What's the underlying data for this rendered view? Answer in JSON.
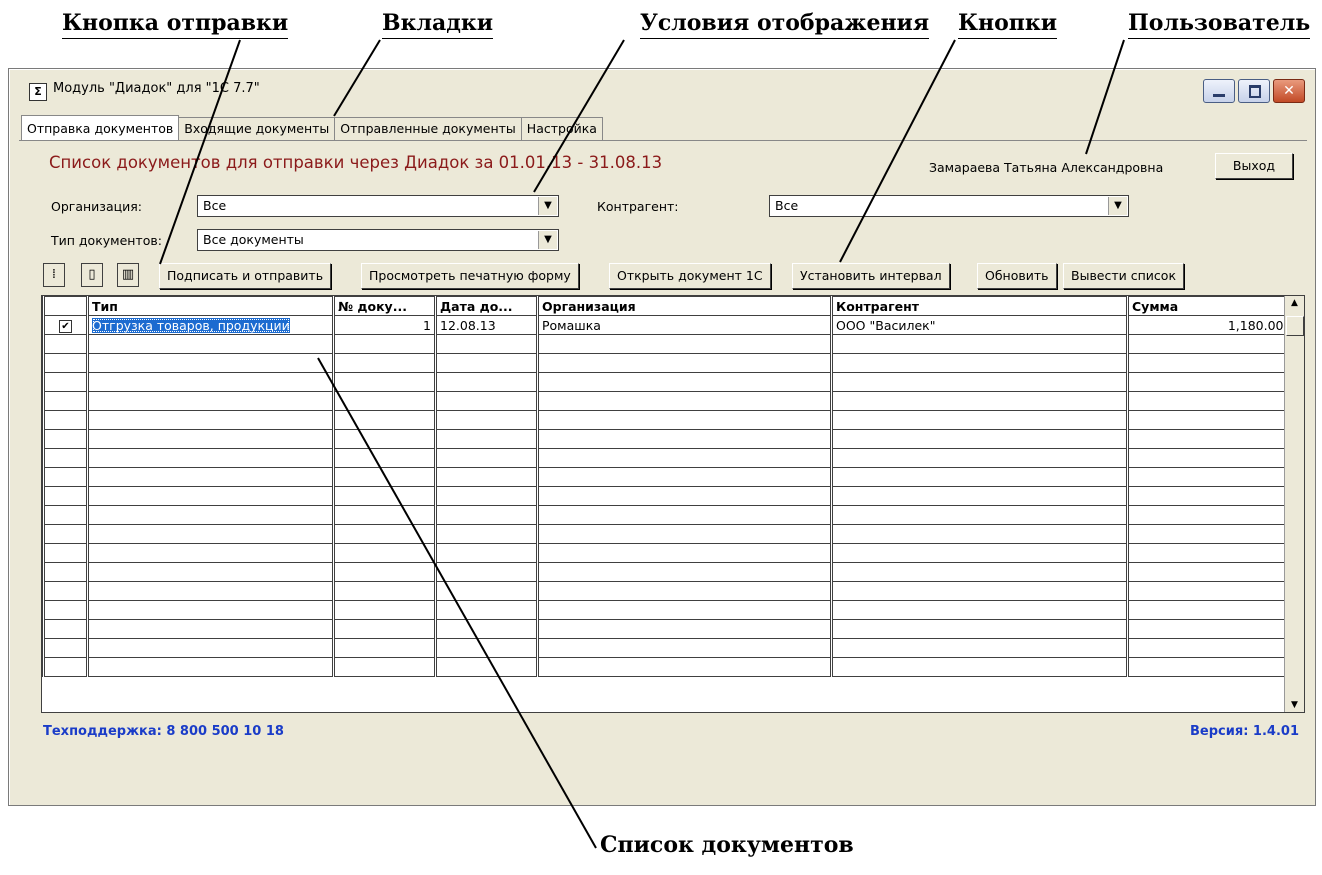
{
  "annotations": {
    "send_button": "Кнопка отправки",
    "tabs": "Вкладки",
    "display_conditions": "Условия отображения",
    "buttons": "Кнопки",
    "user": "Пользователь",
    "doc_list": "Список документов"
  },
  "window": {
    "icon": "Σ",
    "title": "Модуль \"Диадок\" для \"1С 7.7\"",
    "close_glyph": "✕"
  },
  "tabs": [
    {
      "label": "Отправка документов",
      "active": true
    },
    {
      "label": "Входящие документы"
    },
    {
      "label": "Отправленные документы"
    },
    {
      "label": "Настройка"
    }
  ],
  "header": {
    "list_heading": "Список документов для отправки через Диадок за 01.01.13 - 31.08.13",
    "user_name": "Замараева Татьяна Александровна",
    "exit_label": "Выход"
  },
  "filters": {
    "org_label": "Организация:",
    "org_value": "Все",
    "contractor_label": "Контрагент:",
    "contractor_value": "Все",
    "doc_type_label": "Тип документов:",
    "doc_type_value": "Все документы"
  },
  "toolbar": {
    "icons": [
      "select-all-icon",
      "deselect-all-icon",
      "invert-selection-icon"
    ],
    "sign_send": "Подписать и отправить",
    "print_preview": "Просмотреть печатную форму",
    "open_1c": "Открыть документ 1С",
    "set_interval": "Установить интервал",
    "refresh": "Обновить",
    "export_list": "Вывести список"
  },
  "table": {
    "columns": [
      "",
      "Тип",
      "№ доку...",
      "Дата до...",
      "Организация",
      "Контрагент",
      "Сумма"
    ],
    "rows": [
      {
        "checked": true,
        "type": "Отгрузка товаров, продукции",
        "number": "1",
        "date": "12.08.13",
        "organization": "Ромашка",
        "contractor": "ООО \"Василек\"",
        "amount": "1,180.00"
      }
    ],
    "empty_rows": 18
  },
  "footer": {
    "support": "Техподдержка: 8 800 500 10 18",
    "version": "Версия: 1.4.01"
  }
}
